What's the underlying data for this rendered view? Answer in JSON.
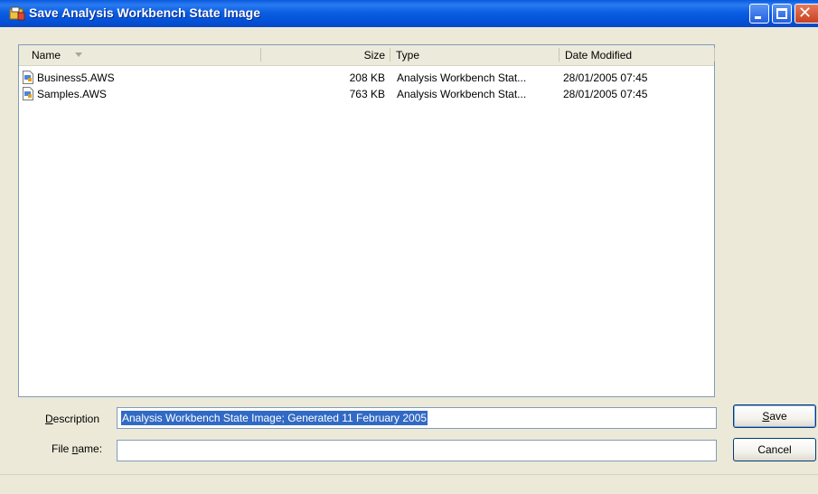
{
  "window": {
    "title": "Save Analysis Workbench State Image"
  },
  "filelist": {
    "columns": {
      "name": "Name",
      "size": "Size",
      "type": "Type",
      "date": "Date Modified"
    },
    "sort_indicator": "sort-descending-icon",
    "rows": [
      {
        "name": "Business5.AWS",
        "size": "208 KB",
        "type": "Analysis Workbench Stat...",
        "date": "28/01/2005 07:45"
      },
      {
        "name": "Samples.AWS",
        "size": "763 KB",
        "type": "Analysis Workbench Stat...",
        "date": "28/01/2005 07:45"
      }
    ]
  },
  "form": {
    "description": {
      "label_mnemonic": "D",
      "label_rest": "escription",
      "value": "Analysis Workbench State Image; Generated 11 February 2005"
    },
    "filename": {
      "label_before": "File ",
      "label_mnemonic": "n",
      "label_after": "ame:",
      "value": ""
    }
  },
  "buttons": {
    "save_mnemonic": "S",
    "save_rest": "ave",
    "cancel": "Cancel"
  },
  "colors": {
    "titlebar": "#0350d6",
    "selection": "#316ac5",
    "dialog_bg": "#ece9d8"
  }
}
